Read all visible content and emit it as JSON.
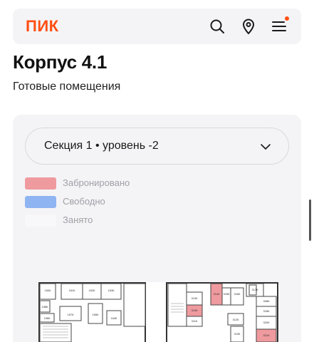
{
  "header": {
    "logo": "ПИК",
    "icons": [
      "search-icon",
      "location-pin-icon",
      "menu-icon"
    ],
    "accent": "#ff4f12"
  },
  "page": {
    "title": "Корпус 4.1",
    "subtitle": "Готовые помещения"
  },
  "selector": {
    "value": "Секция 1 • уровень -2"
  },
  "legend": {
    "items": [
      {
        "label": "Забронировано",
        "color": "#ef9a9e"
      },
      {
        "label": "Свободно",
        "color": "#8fb4f2"
      },
      {
        "label": "Занято",
        "color": "#f8f8fa"
      }
    ]
  },
  "plan": {
    "rooms_left": [
      "160К",
      "161К",
      "162К",
      "163К",
      "158К",
      "157К",
      "165К",
      "156К",
      "164К"
    ],
    "rooms_right": [
      "313К",
      "314К",
      "315К",
      "316К",
      "317К",
      "310К",
      "308К",
      "311К",
      "312К",
      "318К",
      "319К",
      "320К",
      "321К",
      "309К"
    ],
    "booked_rooms": [
      "314К",
      "310К",
      "321К"
    ]
  }
}
